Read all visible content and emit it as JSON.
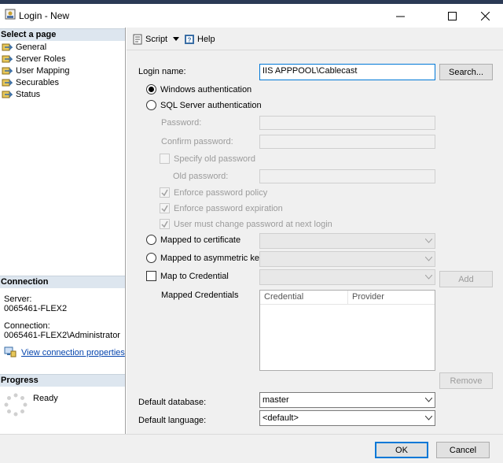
{
  "window": {
    "title": "Login - New"
  },
  "left": {
    "select_page": "Select a page",
    "pages": [
      {
        "label": "General",
        "selected": true
      },
      {
        "label": "Server Roles",
        "selected": false
      },
      {
        "label": "User Mapping",
        "selected": false
      },
      {
        "label": "Securables",
        "selected": false
      },
      {
        "label": "Status",
        "selected": false
      }
    ],
    "connection_header": "Connection",
    "server_label": "Server:",
    "server_value": "0065461-FLEX2",
    "connection_label": "Connection:",
    "connection_value": "0065461-FLEX2\\Administrator",
    "view_props": "View connection properties",
    "progress_header": "Progress",
    "progress_status": "Ready"
  },
  "toolbar": {
    "script": "Script",
    "help": "Help"
  },
  "form": {
    "login_name_label": "Login name:",
    "login_name_value": "IIS APPPOOL\\Cablecast",
    "search_button": "Search...",
    "windows_auth": "Windows authentication",
    "sql_auth": "SQL Server authentication",
    "password_label": "Password:",
    "confirm_password_label": "Confirm password:",
    "specify_old_password": "Specify old password",
    "old_password_label": "Old password:",
    "enforce_policy": "Enforce password policy",
    "enforce_expiration": "Enforce password expiration",
    "must_change": "User must change password at next login",
    "mapped_cert": "Mapped to certificate",
    "mapped_asym": "Mapped to asymmetric key",
    "map_credential": "Map to Credential",
    "add_button": "Add",
    "mapped_credentials_label": "Mapped Credentials",
    "grid_headers": [
      "Credential",
      "Provider"
    ],
    "remove_button": "Remove",
    "default_db_label": "Default database:",
    "default_db_value": "master",
    "default_lang_label": "Default language:",
    "default_lang_value": "<default>"
  },
  "footer": {
    "ok": "OK",
    "cancel": "Cancel"
  },
  "colors": {
    "section_header": "#dde6ef",
    "title_strip": "#2b3a55",
    "link": "#0645ad"
  }
}
